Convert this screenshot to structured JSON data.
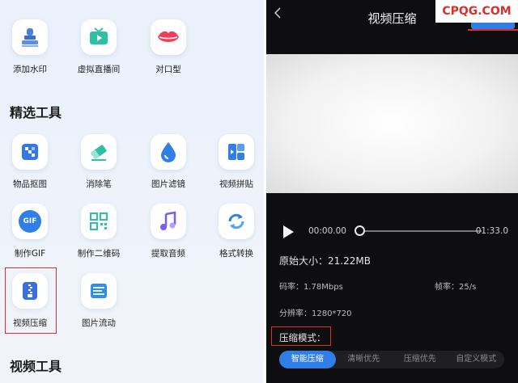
{
  "left": {
    "top_row": [
      {
        "label": "添加水印",
        "icon": "stamp-icon"
      },
      {
        "label": "虚拟直播间",
        "icon": "tv-icon"
      },
      {
        "label": "对口型",
        "icon": "lips-icon"
      }
    ],
    "section_featured": "精选工具",
    "featured": [
      {
        "label": "物品抠图",
        "icon": "image-cutout-icon"
      },
      {
        "label": "消除笔",
        "icon": "eraser-icon"
      },
      {
        "label": "图片滤镜",
        "icon": "drop-icon"
      },
      {
        "label": "视频拼贴",
        "icon": "collage-icon"
      },
      {
        "label": "制作GIF",
        "icon": "gif-icon",
        "icon_text": "GIF"
      },
      {
        "label": "制作二维码",
        "icon": "qrcode-icon"
      },
      {
        "label": "提取音频",
        "icon": "music-note-icon"
      },
      {
        "label": "格式转换",
        "icon": "convert-arrows-icon"
      },
      {
        "label": "视频压缩",
        "icon": "compress-icon"
      },
      {
        "label": "图片流动",
        "icon": "image-flow-icon"
      }
    ],
    "section_video": "视频工具"
  },
  "right": {
    "title": "视频压缩",
    "brand": "CPQG.COM",
    "time_start": "00:00.00",
    "time_end": "01:33.0",
    "progress": 0,
    "original_size": "原始大小：21.22MB",
    "bitrate": "码率：1.78Mbps",
    "framerate": "帧率：25/s",
    "resolution": "分辨率：1280*720",
    "mode_label": "压缩模式：",
    "modes": [
      "智能压缩",
      "清晰优先",
      "压缩优先",
      "自定义模式"
    ],
    "active_mode": 0
  },
  "colors": {
    "accent": "#2f7fe6",
    "highlight": "#d9302c",
    "dark_bg": "#0e0e10"
  }
}
